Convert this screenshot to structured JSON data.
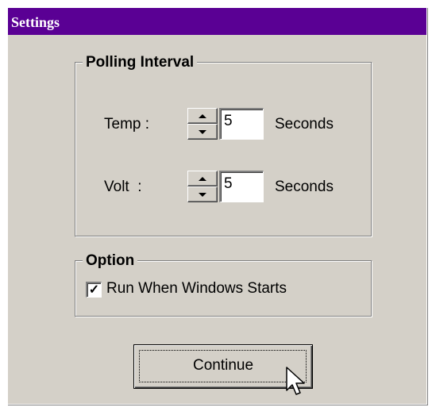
{
  "window": {
    "title": "Settings"
  },
  "polling": {
    "title": "Polling Interval",
    "rows": [
      {
        "label": "Temp :",
        "value": "5",
        "unit": "Seconds"
      },
      {
        "label": "Volt  :",
        "value": "5",
        "unit": "Seconds"
      }
    ]
  },
  "option": {
    "title": "Option",
    "checkbox_label": "Run When Windows Starts",
    "checked": true
  },
  "actions": {
    "continue_label": "Continue"
  },
  "icons": [
    "spin-up-icon",
    "spin-down-icon",
    "checkmark-icon",
    "mouse-cursor-icon"
  ],
  "colors": {
    "titlebar": "#5a0094",
    "face": "#d4d0c8"
  }
}
